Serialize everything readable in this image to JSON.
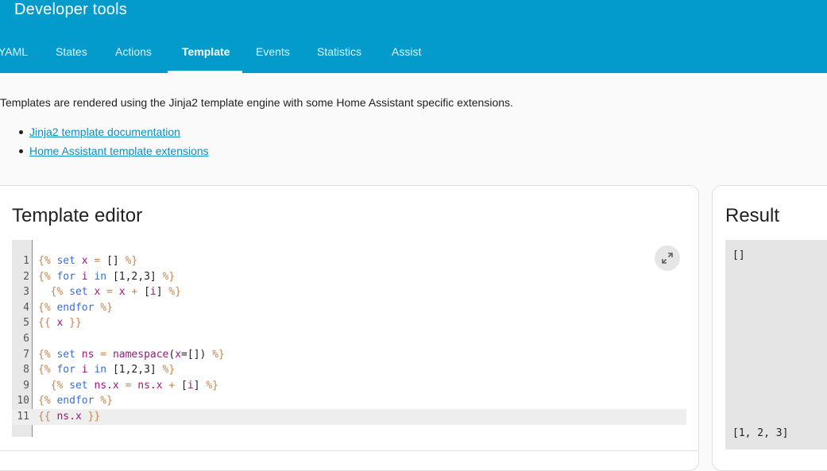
{
  "header": {
    "title": "Developer tools",
    "background": "#039bcb",
    "tabs": [
      {
        "label": "YAML"
      },
      {
        "label": "States"
      },
      {
        "label": "Actions"
      },
      {
        "label": "Template"
      },
      {
        "label": "Events"
      },
      {
        "label": "Statistics"
      },
      {
        "label": "Assist"
      }
    ],
    "active_tab": "Template"
  },
  "intro": {
    "text": "Templates are rendered using the Jinja2 template engine with some Home Assistant specific extensions.",
    "links": [
      {
        "label": "Jinja2 template documentation"
      },
      {
        "label": "Home Assistant template extensions"
      }
    ]
  },
  "editor": {
    "title": "Template editor",
    "expand_icon": "expand-icon",
    "lines": [
      {
        "num": "1",
        "text": "{% set x = [] %}"
      },
      {
        "num": "2",
        "text": "{% for i in [1,2,3] %}"
      },
      {
        "num": "3",
        "text": "  {% set x = x + [i] %}"
      },
      {
        "num": "4",
        "text": "{% endfor %}"
      },
      {
        "num": "5",
        "text": "{{ x }}"
      },
      {
        "num": "6",
        "text": ""
      },
      {
        "num": "7",
        "text": "{% set ns = namespace(x=[]) %}"
      },
      {
        "num": "8",
        "text": "{% for i in [1,2,3] %}"
      },
      {
        "num": "9",
        "text": "  {% set ns.x = ns.x + [i] %}"
      },
      {
        "num": "10",
        "text": "{% endfor %}"
      },
      {
        "num": "11",
        "text": "{{ ns.x }}"
      }
    ],
    "active_line": "11"
  },
  "result": {
    "title": "Result",
    "first_line": "[]",
    "last_line": "[1, 2, 3]"
  }
}
